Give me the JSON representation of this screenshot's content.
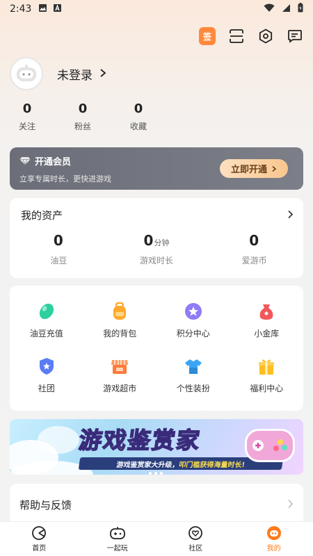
{
  "status_bar": {
    "time": "2:43"
  },
  "top_actions": {
    "checkin_label": "签"
  },
  "profile": {
    "login_text": "未登录"
  },
  "stats": [
    {
      "value": "0",
      "label": "关注"
    },
    {
      "value": "0",
      "label": "粉丝"
    },
    {
      "value": "0",
      "label": "收藏"
    }
  ],
  "vip": {
    "title": "开通会员",
    "subtitle": "立享专属时长，更快进游戏",
    "button": "立即开通"
  },
  "assets": {
    "title": "我的资产",
    "items": [
      {
        "value": "0",
        "unit": "",
        "label": "油豆"
      },
      {
        "value": "0",
        "unit": "分钟",
        "label": "游戏时长"
      },
      {
        "value": "0",
        "unit": "",
        "label": "爱游币"
      }
    ]
  },
  "grid": {
    "items": [
      {
        "label": "油豆充值",
        "icon": "bean-icon",
        "color": "#2ecf9e"
      },
      {
        "label": "我的背包",
        "icon": "backpack-icon",
        "color": "#ffaa2c"
      },
      {
        "label": "积分中心",
        "icon": "points-icon",
        "color": "#8f7cf6"
      },
      {
        "label": "小金库",
        "icon": "purse-icon",
        "color": "#f2585b"
      },
      {
        "label": "社团",
        "icon": "shield-icon",
        "color": "#5b7cf5"
      },
      {
        "label": "游戏超市",
        "icon": "store-icon",
        "color": "#ff7b3c"
      },
      {
        "label": "个性装扮",
        "icon": "tshirt-icon",
        "color": "#3aa5f5"
      },
      {
        "label": "福利中心",
        "icon": "gift-icon",
        "color": "#ffbd22"
      }
    ]
  },
  "banner": {
    "title": "游戏鉴赏家",
    "strip_text_a": "游戏鉴赏家大升级，",
    "strip_text_b": "叩门槛获得海量时长!"
  },
  "help": {
    "label": "帮助与反馈"
  },
  "tabs": [
    {
      "label": "首页",
      "icon": "home-icon",
      "active": false
    },
    {
      "label": "一起玩",
      "icon": "gamepad-icon",
      "active": false
    },
    {
      "label": "社区",
      "icon": "community-icon",
      "active": false
    },
    {
      "label": "我的",
      "icon": "me-icon",
      "active": true
    }
  ]
}
